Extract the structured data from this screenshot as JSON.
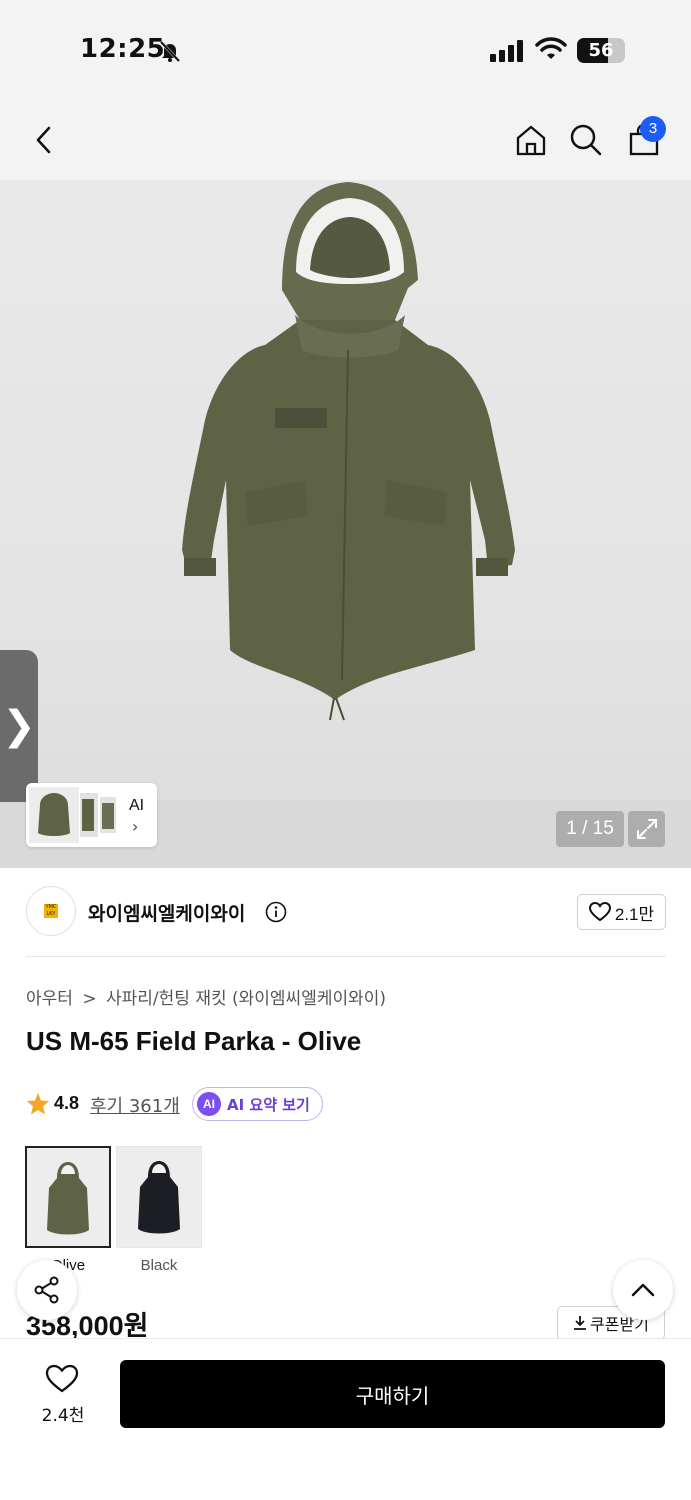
{
  "status_bar": {
    "time": "12:25",
    "battery": "56"
  },
  "nav": {
    "cart_count": "3"
  },
  "gallery": {
    "counter": "1 / 15",
    "ai_label": "AI"
  },
  "brand": {
    "name": "와이엠씨엘케이와이",
    "logo_text": "YMC LKY",
    "likes": "2.1만"
  },
  "breadcrumb": {
    "category": "아우터",
    "separator": ">",
    "subcategory": "사파리/헌팅 재킷 (와이엠씨엘케이와이)"
  },
  "product": {
    "title": "US M-65 Field Parka - Olive",
    "rating": "4.8",
    "reviews": "후기 361개",
    "ai_badge": "AI",
    "ai_summary": "AI 요약 보기",
    "price": "358,000원",
    "coupon": "쿠폰받기"
  },
  "colors": [
    {
      "label": "Olive",
      "swatch": "#5f6346",
      "selected": true
    },
    {
      "label": "Black",
      "swatch": "#1c1e24",
      "selected": false
    }
  ],
  "bottom": {
    "wish_count": "2.4천",
    "buy_label": "구매하기"
  },
  "accent": {
    "badge_blue": "#1e5cf7",
    "ai_purple": "#7b4ff0",
    "star": "#f5a623"
  },
  "icons": [
    "back-arrow-icon",
    "home-icon",
    "search-icon",
    "bag-icon",
    "bell-off-icon",
    "signal-icon",
    "wifi-icon",
    "heart-icon",
    "share-icon",
    "chevron-up-icon",
    "expand-icon",
    "info-icon",
    "star-icon",
    "download-icon"
  ]
}
